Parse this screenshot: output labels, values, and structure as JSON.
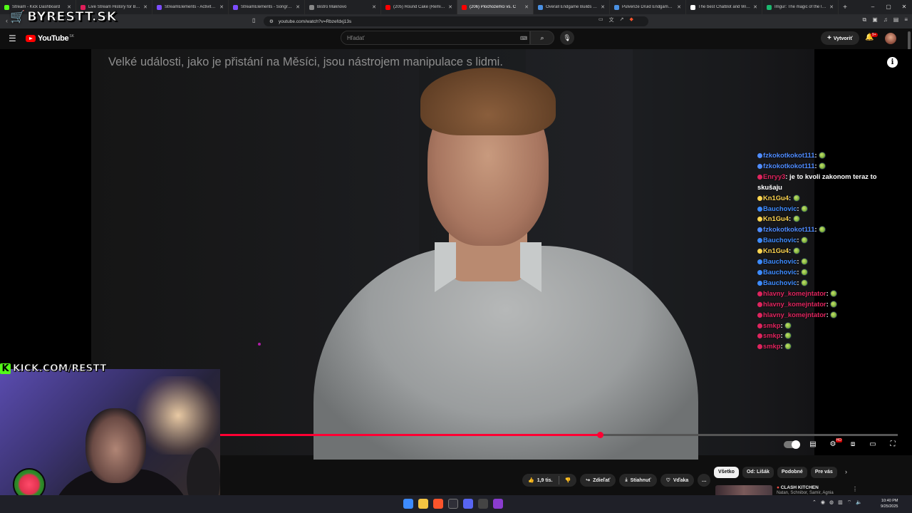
{
  "browser": {
    "tabs": [
      {
        "title": "Stream - Kick Dashboard",
        "color": "#53fc18"
      },
      {
        "title": "Live Stream History for Blerp S",
        "color": "#e01e5a"
      },
      {
        "title": "StreamElements - Activity feed",
        "color": "#7c4dff"
      },
      {
        "title": "StreamElements - Songrequest",
        "color": "#7c4dff"
      },
      {
        "title": "Bistro Maknovo",
        "color": "#888888"
      },
      {
        "title": "(205) Round Cake (Remix) [Drei",
        "color": "#ff0000"
      },
      {
        "title": "(206) Plochozemci vs. C",
        "color": "#ff0000",
        "active": true
      },
      {
        "title": "Overall Endgame Builds Tier Li",
        "color": "#4a90e2"
      },
      {
        "title": "Pulverize Druid Endgame Guide",
        "color": "#4a90e2"
      },
      {
        "title": "The best ChatBot and Widgets",
        "color": "#ffffff"
      },
      {
        "title": "Imgur: The magic of the Intern",
        "color": "#1bb76e"
      }
    ],
    "url": "youtube.com/watch?v=Rbzefdxj13s"
  },
  "overlay": {
    "brand": "BYRESTT.SK",
    "kick_label": "KICK.COM/RESTT",
    "kick_letter": "K"
  },
  "youtube": {
    "logo": "YouTube",
    "region": "SK",
    "search_placeholder": "Hľadať",
    "create_label": "Vytvoriť",
    "notif_count": "9+",
    "caption": "Velké události, jako je přistání na Měsíci, jsou nástrojem manipulace s lidmi.",
    "progress": 0.56,
    "likes": "1,9 tis.",
    "share": "Zdieľať",
    "download": "Stiahnuť",
    "thanks": "Vďaka",
    "chips": [
      {
        "label": "Všetko",
        "selected": true
      },
      {
        "label": "Od: Lišák",
        "selected": false
      },
      {
        "label": "Podobné",
        "selected": false
      },
      {
        "label": "Pre vás",
        "selected": false
      }
    ],
    "rec": {
      "title": "CLASH KITCHEN",
      "channel": "Natan, Schnibor, Samir, Agnia"
    }
  },
  "chat": [
    {
      "user": "fzkokotkokot111",
      "color": "#4f8cff",
      "msg": ""
    },
    {
      "user": "fzkokotkokot111",
      "color": "#4f8cff",
      "msg": ""
    },
    {
      "user": "Enryy3",
      "color": "#e0245e",
      "msg": "je to kvoli zakonom teraz to skušaju"
    },
    {
      "user": "Kn1Gu4",
      "color": "#ffd54f",
      "msg": ""
    },
    {
      "user": "Bauchovic",
      "color": "#3d8bff",
      "msg": ""
    },
    {
      "user": "Kn1Gu4",
      "color": "#ffd54f",
      "msg": ""
    },
    {
      "user": "fzkokotkokot111",
      "color": "#4f8cff",
      "msg": ""
    },
    {
      "user": "Bauchovic",
      "color": "#3d8bff",
      "msg": ""
    },
    {
      "user": "Kn1Gu4",
      "color": "#ffd54f",
      "msg": ""
    },
    {
      "user": "Bauchovic",
      "color": "#3d8bff",
      "msg": ""
    },
    {
      "user": "Bauchovic",
      "color": "#3d8bff",
      "msg": ""
    },
    {
      "user": "Bauchovic",
      "color": "#3d8bff",
      "msg": ""
    },
    {
      "user": "hlavny_komejntator",
      "color": "#e0245e",
      "msg": ""
    },
    {
      "user": "hlavny_komejntator",
      "color": "#e0245e",
      "msg": ""
    },
    {
      "user": "hlavny_komejntator",
      "color": "#e0245e",
      "msg": ""
    },
    {
      "user": "smkp",
      "color": "#e0245e",
      "msg": ""
    },
    {
      "user": "smkp",
      "color": "#e0245e",
      "msg": ""
    },
    {
      "user": "smkp",
      "color": "#e0245e",
      "msg": ""
    }
  ],
  "taskbar": {
    "time": "10:40 PM",
    "date": "9/25/2025"
  }
}
